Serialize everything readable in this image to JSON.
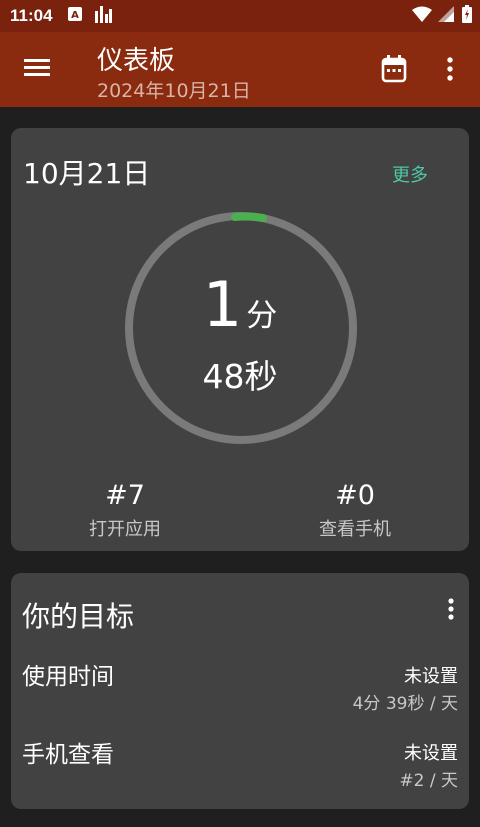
{
  "status_bar": {
    "time": "11:04",
    "icons": [
      "font-a-icon",
      "chart-bars-icon",
      "wifi-icon",
      "signal-icon",
      "battery-icon"
    ]
  },
  "app_bar": {
    "title": "仪表板",
    "subtitle": "2024年10月21日",
    "icons": [
      "menu-icon",
      "calendar-icon",
      "more-vert-icon"
    ]
  },
  "summary_card": {
    "date": "10月21日",
    "more_label": "更多",
    "usage_minutes": "1",
    "minutes_unit": "分",
    "usage_seconds": "48秒",
    "unlocks_value": "#7",
    "unlocks_label": "打开应用",
    "checks_value": "#0",
    "checks_label": "查看手机",
    "colors": {
      "ring_track": "#7a7a7a",
      "ring_progress": "#4caf50",
      "accent": "#4dc7a6"
    }
  },
  "goals_card": {
    "title": "你的目标",
    "items": [
      {
        "name": "使用时间",
        "status": "未设置",
        "detail": "4分 39秒 / 天"
      },
      {
        "name": "手机查看",
        "status": "未设置",
        "detail": "#2 / 天"
      }
    ]
  },
  "colors": {
    "status_bar": "#7a220d",
    "app_bar": "#8a2a0e",
    "background": "#1f1f1f",
    "card": "#424242"
  }
}
